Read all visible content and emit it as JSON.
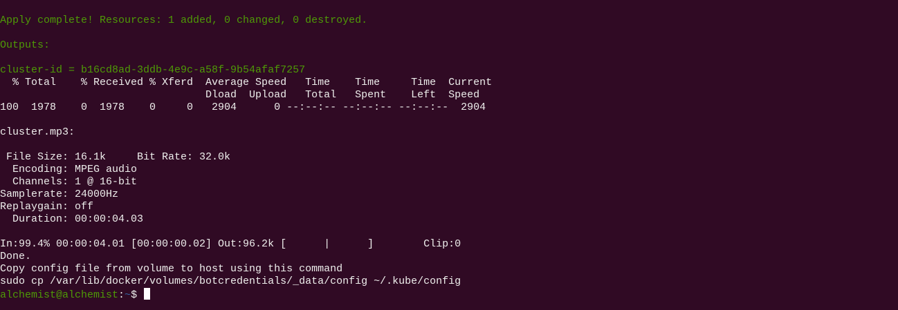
{
  "terminal": {
    "colors": {
      "background": "#300a24",
      "text": "#eeeeec",
      "green": "#4e9a06",
      "blue": "#3465a4"
    },
    "apply_line": "Apply complete! Resources: 1 added, 0 changed, 0 destroyed.",
    "outputs_label": "Outputs:",
    "cluster_id_line": "cluster-id = b16cd8ad-3ddb-4e9c-a58f-9b54afaf7257",
    "curl": {
      "header1": "  % Total    % Received % Xferd  Average Speed   Time    Time     Time  Current",
      "header2": "                                 Dload  Upload   Total   Spent    Left  Speed",
      "row": "100  1978    0  1978    0     0   2904      0 --:--:-- --:--:-- --:--:--  2904"
    },
    "sox": {
      "file": "cluster.mp3:",
      "file_size": " File Size: 16.1k     Bit Rate: 32.0k",
      "encoding": "  Encoding: MPEG audio",
      "channels": "  Channels: 1 @ 16-bit",
      "samplerate": "Samplerate: 24000Hz",
      "replaygain": "Replaygain: off",
      "duration": "  Duration: 00:00:04.03",
      "progress": "In:99.4% 00:00:04.01 [00:00:00.02] Out:96.2k [      |      ]        Clip:0",
      "done": "Done."
    },
    "copy_msg": "Copy config file from volume to host using this command",
    "copy_cmd": "sudo cp /var/lib/docker/volumes/botcredentials/_data/config ~/.kube/config",
    "prompt": {
      "user_host": "alchemist@alchemist",
      "sep": ":",
      "path": "~",
      "symbol": "$ "
    }
  }
}
